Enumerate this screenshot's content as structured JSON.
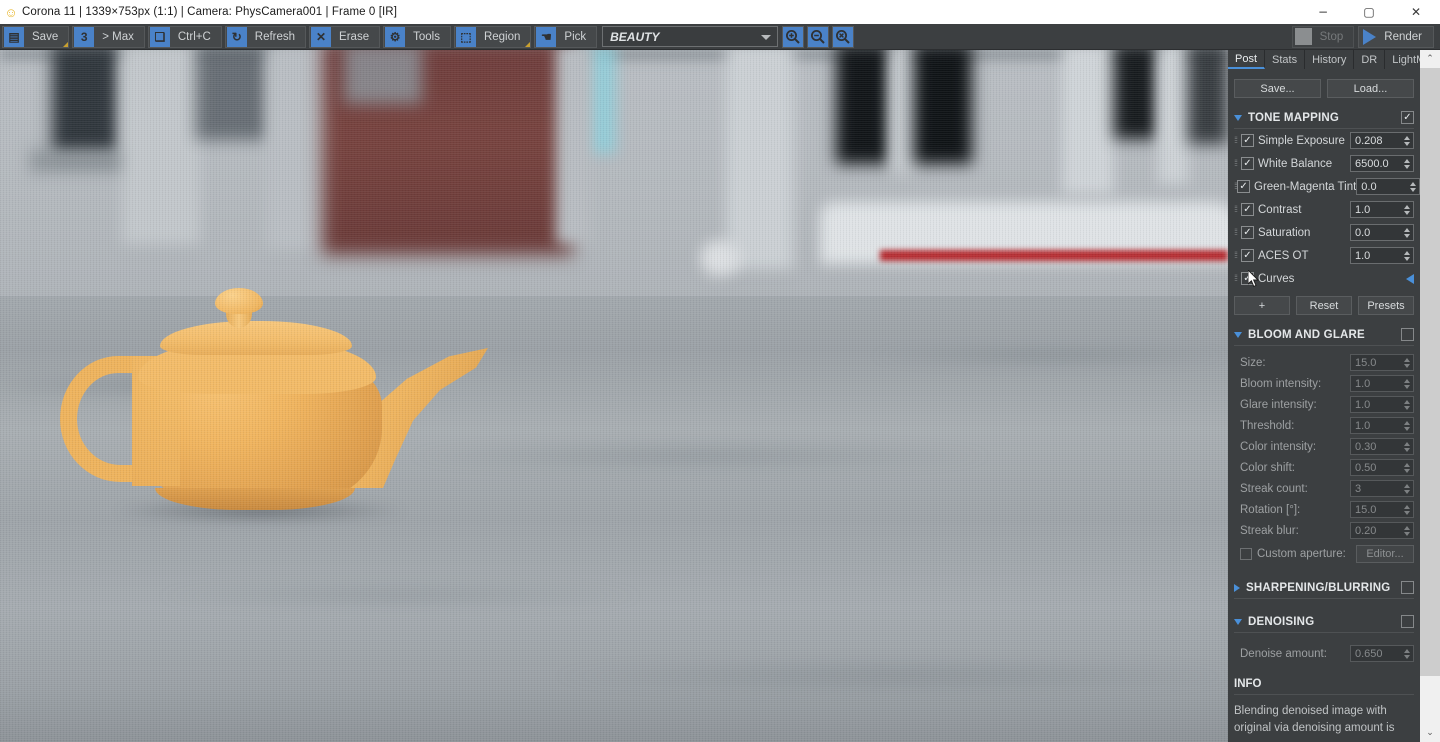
{
  "window": {
    "title": "Corona 11 | 1339×753px (1:1) | Camera: PhysCamera001 | Frame 0 [IR]",
    "app_icon": "corona-smiley-icon",
    "minimize": "−",
    "maximize": "▢",
    "close": "✕"
  },
  "toolbar": {
    "buttons": [
      {
        "label": "Save",
        "icon": "floppy-disk-icon",
        "icon_glyph": "▤",
        "has_dropdown": true
      },
      {
        "label": "> Max",
        "icon": "max-transfer-icon",
        "icon_glyph": "3",
        "has_dropdown": false
      },
      {
        "label": "Ctrl+C",
        "icon": "copy-icon",
        "icon_glyph": "❏",
        "has_dropdown": false
      },
      {
        "label": "Refresh",
        "icon": "refresh-icon",
        "icon_glyph": "↻",
        "has_dropdown": false
      },
      {
        "label": "Erase",
        "icon": "erase-icon",
        "icon_glyph": "✕",
        "has_dropdown": false
      },
      {
        "label": "Tools",
        "icon": "gear-icon",
        "icon_glyph": "⚙",
        "has_dropdown": false
      },
      {
        "label": "Region",
        "icon": "region-icon",
        "icon_glyph": "⬚",
        "has_dropdown": true
      },
      {
        "label": "Pick",
        "icon": "pick-hand-icon",
        "icon_glyph": "☚",
        "has_dropdown": false
      }
    ],
    "render_element": {
      "value": "BEAUTY"
    },
    "zoom_buttons": [
      {
        "name": "zoom-in-icon",
        "glyph": "+"
      },
      {
        "name": "zoom-out-icon",
        "glyph": "−"
      },
      {
        "name": "zoom-reset-icon",
        "glyph": "×"
      }
    ],
    "stop": {
      "label": "Stop",
      "enabled": false
    },
    "render": {
      "label": "Render",
      "enabled": true
    }
  },
  "panel": {
    "tabs": [
      {
        "label": "Post",
        "active": true
      },
      {
        "label": "Stats",
        "active": false
      },
      {
        "label": "History",
        "active": false
      },
      {
        "label": "DR",
        "active": false
      },
      {
        "label": "LightMix",
        "active": false
      }
    ],
    "save_label": "Save...",
    "load_label": "Load...",
    "tone_mapping": {
      "title": "TONE MAPPING",
      "enabled": true,
      "expanded": true,
      "operators": [
        {
          "label": "Simple Exposure",
          "checked": true,
          "value": "0.208",
          "type": "spinner"
        },
        {
          "label": "White Balance",
          "checked": true,
          "value": "6500.0",
          "type": "spinner"
        },
        {
          "label": "Green-Magenta Tint",
          "checked": true,
          "value": "0.0",
          "type": "spinner"
        },
        {
          "label": "Contrast",
          "checked": true,
          "value": "1.0",
          "type": "spinner"
        },
        {
          "label": "Saturation",
          "checked": true,
          "value": "0.0",
          "type": "spinner"
        },
        {
          "label": "ACES OT",
          "checked": true,
          "value": "1.0",
          "type": "spinner"
        },
        {
          "label": "Curves",
          "checked": true,
          "value": "",
          "type": "expand-left"
        }
      ],
      "add_label": "+",
      "reset_label": "Reset",
      "presets_label": "Presets"
    },
    "bloom_and_glare": {
      "title": "BLOOM AND GLARE",
      "enabled": false,
      "expanded": true,
      "fields": [
        {
          "label": "Size:",
          "value": "15.0"
        },
        {
          "label": "Bloom intensity:",
          "value": "1.0"
        },
        {
          "label": "Glare intensity:",
          "value": "1.0"
        },
        {
          "label": "Threshold:",
          "value": "1.0"
        },
        {
          "label": "Color intensity:",
          "value": "0.30"
        },
        {
          "label": "Color shift:",
          "value": "0.50"
        },
        {
          "label": "Streak count:",
          "value": "3"
        },
        {
          "label": "Rotation [°]:",
          "value": "15.0"
        },
        {
          "label": "Streak blur:",
          "value": "0.20"
        }
      ],
      "custom_aperture": {
        "label": "Custom aperture:",
        "checked": false,
        "button": "Editor..."
      }
    },
    "sharpening_blurring": {
      "title": "SHARPENING/BLURRING",
      "enabled": false,
      "expanded": false
    },
    "denoising": {
      "title": "DENOISING",
      "enabled": false,
      "expanded": true,
      "fields": [
        {
          "label": "Denoise amount:",
          "value": "0.650"
        }
      ]
    },
    "info": {
      "title": "INFO",
      "text": "Blending denoised image with original via denoising amount is"
    }
  },
  "render_view": {
    "scene": "yellow-teapot-on-street",
    "element": "BEAUTY"
  },
  "colors": {
    "accent_blue": "#4a90d9",
    "toolbar_icon_blue": "#4a82c8",
    "panel_bg": "#3c3f41",
    "titlebar_bg": "#ffffff",
    "teapot": "#f0b45e",
    "red_stripe": "#b4272c"
  }
}
